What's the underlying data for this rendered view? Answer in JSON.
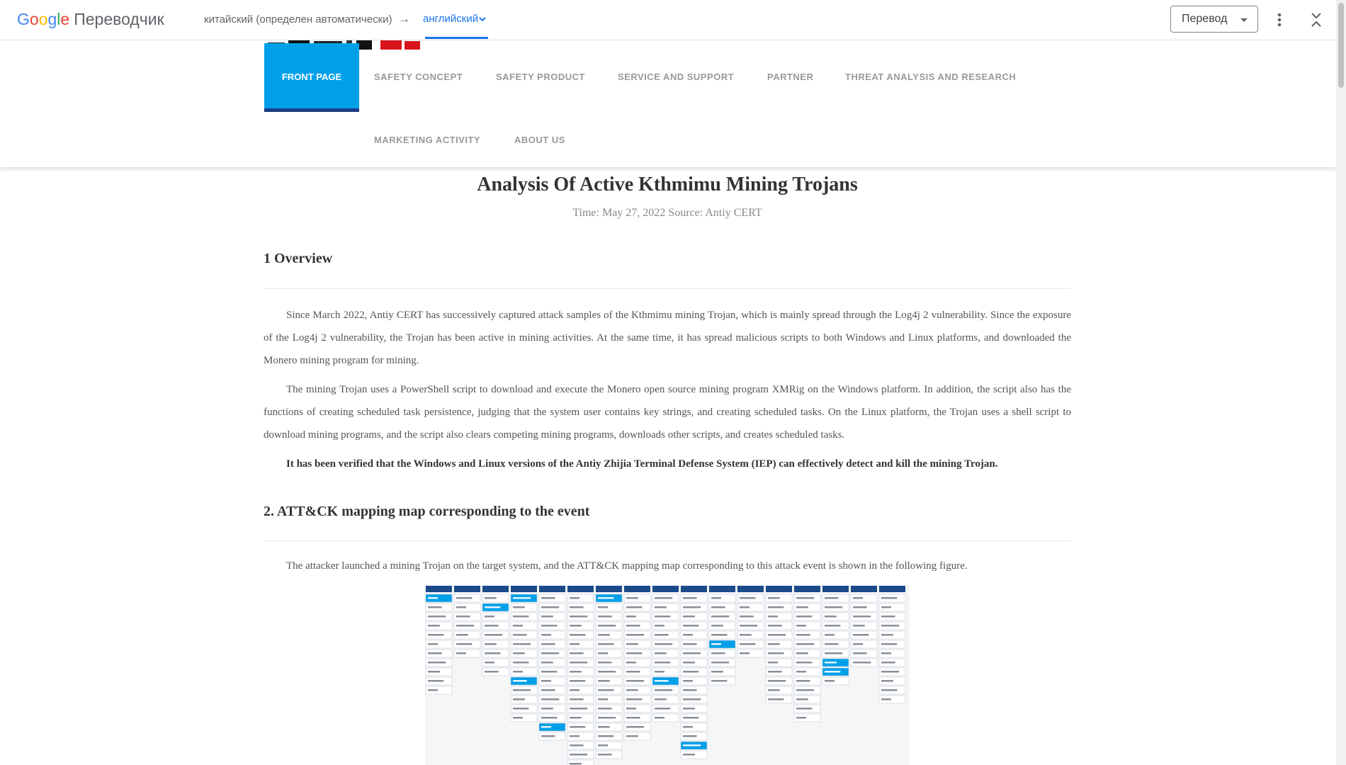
{
  "translate_bar": {
    "logo_letters": [
      "G",
      "o",
      "o",
      "g",
      "l",
      "e"
    ],
    "product": "Переводчик",
    "source_lang": "китайский (определен автоматически)",
    "arrow": "→",
    "target_lang": "английский",
    "target_icon": "chevron-down-icon",
    "mode_select": "Перевод",
    "more_icon": "more-vert-icon",
    "collapse_icon": "collapse-icon",
    "colors": {
      "blue": "#4285f4",
      "red": "#ea4335",
      "yellow": "#fbbc05",
      "green": "#34a853",
      "link": "#1a73e8"
    }
  },
  "site_nav": {
    "items": [
      {
        "label": "FRONT PAGE",
        "active": true
      },
      {
        "label": "SAFETY CONCEPT"
      },
      {
        "label": "SAFETY PRODUCT"
      },
      {
        "label": "SERVICE AND SUPPORT"
      },
      {
        "label": "PARTNER"
      },
      {
        "label": "THREAT ANALYSIS AND RESEARCH"
      },
      {
        "label": "MARKETING ACTIVITY"
      },
      {
        "label": "ABOUT US"
      }
    ],
    "active_color": "#00a0e9"
  },
  "article": {
    "title": "Analysis Of Active Kthmimu Mining Trojans",
    "meta": "Time: May 27, 2022 Source: Antiy CERT",
    "section1_heading": "1 Overview",
    "p1": "Since March 2022, Antiy CERT has successively captured attack samples of the Kthmimu mining Trojan, which is mainly spread through the Log4j 2 vulnerability. Since the exposure of the Log4j 2 vulnerability, the Trojan has been active in mining activities. At the same time, it has spread malicious scripts to both Windows and Linux platforms, and downloaded the Monero mining program for mining.",
    "p2": "The mining Trojan uses a PowerShell script to download and execute the Monero open source mining program XMRig on the Windows platform. In addition, the script also has the functions of creating scheduled task persistence, judging that the system user contains key strings, and creating scheduled tasks. On the Linux platform, the Trojan uses a shell script to download mining programs, and the script also clears competing mining programs, downloads other scripts, and creates scheduled tasks.",
    "p3": "It has been verified that the Windows and Linux versions of the Antiy Zhijia Terminal Defense System (IEP) can effectively detect and kill the mining Trojan.",
    "section2_heading": "2. ATT&CK mapping map corresponding to the event",
    "p4": "The attacker launched a mining Trojan on the target system, and the ATT&CK mapping map corresponding to this attack event is shown in the following figure.",
    "figure_highlight_color": "#00a0e9"
  }
}
